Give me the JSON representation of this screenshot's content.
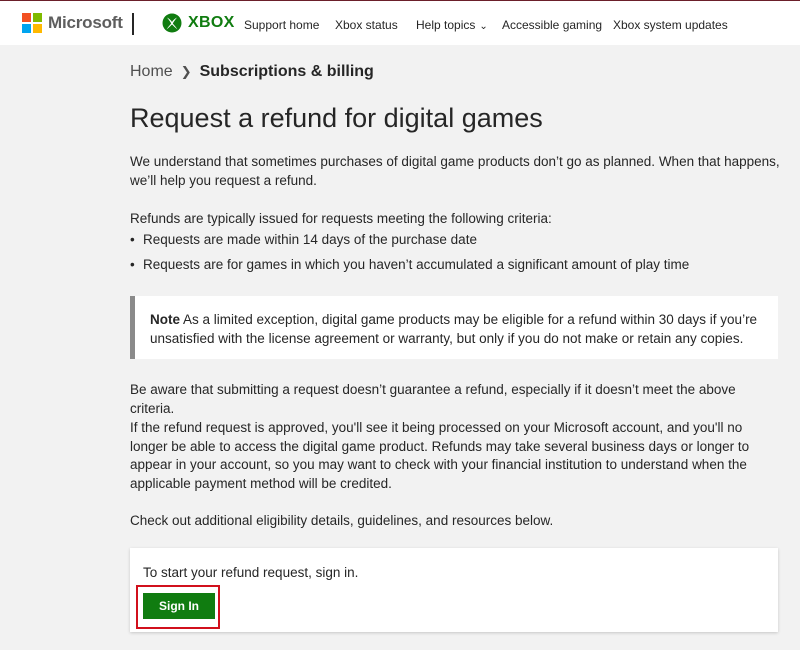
{
  "header": {
    "ms_logo_text": "Microsoft",
    "xbox_logo_text": "XBOX",
    "nav": [
      "Support home",
      "Xbox status",
      "Help topics",
      "Accessible gaming",
      "Xbox system updates"
    ]
  },
  "breadcrumb": {
    "home": "Home",
    "current": "Subscriptions & billing"
  },
  "page": {
    "title": "Request a refund for digital games",
    "intro": "We understand that sometimes purchases of digital game products don’t go as planned. When that happens, we’ll help you request a refund.",
    "criteria_lead": "Refunds are typically issued for requests meeting the following criteria:",
    "criteria": [
      "Requests are made within 14 days of the purchase date",
      "Requests are for games in which you haven’t accumulated a significant amount of play time"
    ],
    "note_label": "Note",
    "note_text": "As a limited exception, digital game products may be eligible for a refund within 30 days if you’re unsatisfied with the license agreement or warranty, but only if you do not make or retain any copies.",
    "aware": "Be aware that submitting a request doesn’t guarantee a refund, especially if it doesn’t meet the above criteria.",
    "approved": "If the refund request is approved, you'll see it being processed on your Microsoft account, and you'll no longer be able to access the digital game product. Refunds may take several business days or longer to appear in your account, so you may want to check with your financial institution to understand when the applicable payment method will be credited.",
    "checkout": "Check out additional eligibility details, guidelines, and resources below."
  },
  "signin": {
    "prompt": "To start your refund request, sign in.",
    "button_label": "Sign In"
  },
  "colors": {
    "xbox_green": "#107c10",
    "highlight_red": "#d1101c"
  }
}
